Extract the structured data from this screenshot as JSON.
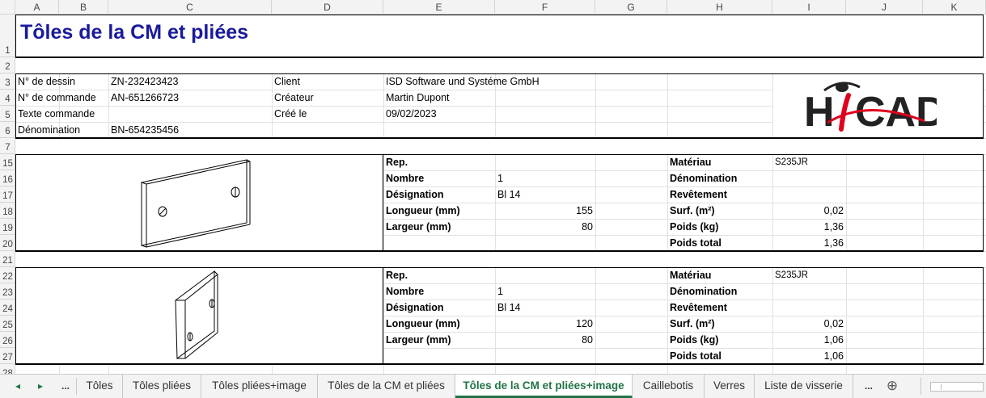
{
  "columns": [
    "A",
    "B",
    "C",
    "D",
    "E",
    "F",
    "G",
    "H",
    "I",
    "J",
    "K"
  ],
  "rows": [
    "1",
    "2",
    "3",
    "4",
    "5",
    "6",
    "7",
    "15",
    "16",
    "17",
    "18",
    "19",
    "20",
    "21",
    "22",
    "23",
    "24",
    "25",
    "26",
    "27",
    "28"
  ],
  "title": "Tôles de la CM et pliées",
  "header": {
    "drawing_label": "N° de dessin",
    "drawing_value": "ZN-232423423",
    "order_label": "N° de commande",
    "order_value": "AN-651266723",
    "order_text_label": "Texte commande",
    "designation_label": "Dénomination",
    "designation_value": "BN-654235456",
    "client_label": "Client",
    "client_value": "ISD Software und Systéme GmbH",
    "creator_label": "Créateur",
    "creator_value": "Martin Dupont",
    "created_label": "Créé le",
    "created_value": "09/02/2023"
  },
  "logo": {
    "text_left": "H",
    "text_right": "CAD",
    "accent_color": "#e0001b"
  },
  "parts": [
    {
      "rep_label": "Rep.",
      "count_label": "Nombre",
      "count_value": "1",
      "desig_label": "Désignation",
      "desig_value": "Bl 14",
      "length_label": "Longueur (mm)",
      "length_value": "155",
      "width_label": "Largeur (mm)",
      "width_value": "80",
      "material_label": "Matériau",
      "material_value": "S235JR",
      "denom_label": "Dénomination",
      "coating_label": "Revêtement",
      "surface_label": "Surf. (m²)",
      "surface_value": "0,02",
      "weight_label": "Poids (kg)",
      "weight_value": "1,36",
      "total_label": "Poids total",
      "total_value": "1,36"
    },
    {
      "rep_label": "Rep.",
      "count_label": "Nombre",
      "count_value": "1",
      "desig_label": "Désignation",
      "desig_value": "Bl 14",
      "length_label": "Longueur (mm)",
      "length_value": "120",
      "width_label": "Largeur (mm)",
      "width_value": "80",
      "material_label": "Matériau",
      "material_value": "S235JR",
      "denom_label": "Dénomination",
      "coating_label": "Revêtement",
      "surface_label": "Surf. (m²)",
      "surface_value": "0,02",
      "weight_label": "Poids (kg)",
      "weight_value": "1,06",
      "total_label": "Poids total",
      "total_value": "1,06"
    }
  ],
  "tabs": {
    "nav_prev": "◂",
    "nav_next": "▸",
    "more_left": "...",
    "more_right": "...",
    "add": "⊕",
    "items": [
      "Tôles",
      "Tôles pliées",
      "Tôles pliées+image",
      "Tôles de la CM et pliées",
      "Tôles de la CM et pliées+image",
      "Caillebotis",
      "Verres",
      "Liste de visserie"
    ],
    "active_index": 4
  },
  "colors": {
    "title": "#1a1a9c",
    "accent": "#217346"
  }
}
